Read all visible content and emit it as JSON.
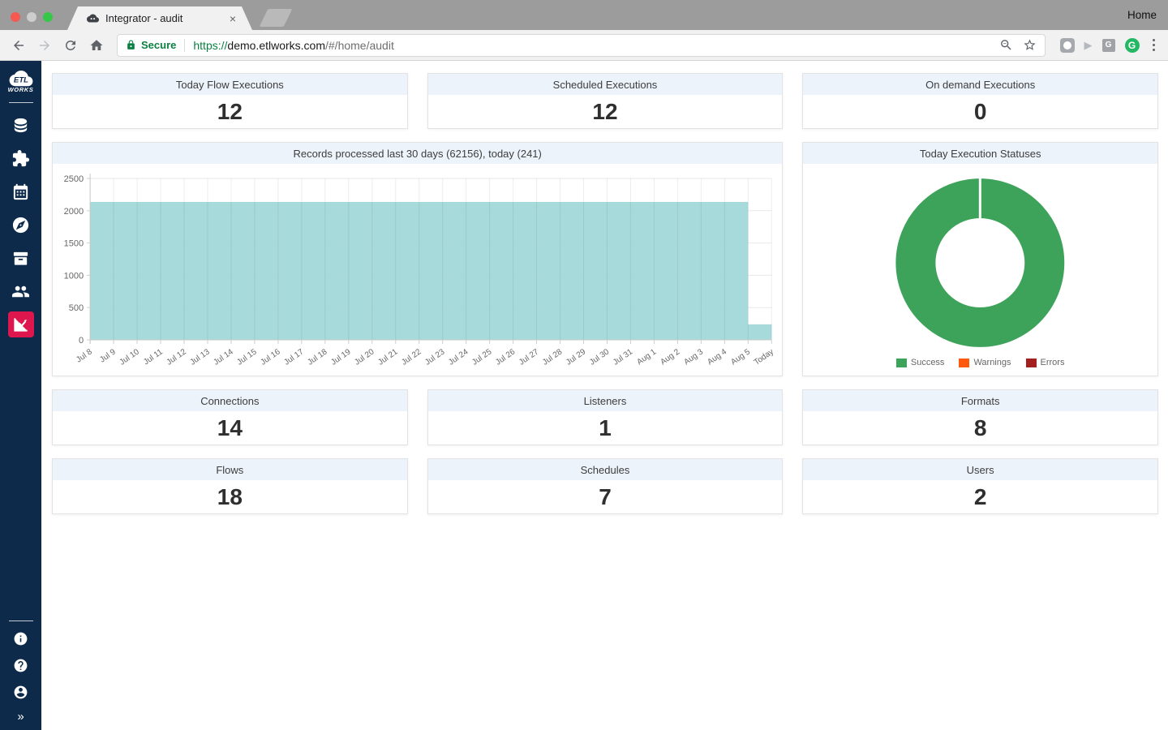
{
  "browser": {
    "frame_home_label": "Home",
    "tab": {
      "title": "Integrator - audit",
      "close_glyph": "×"
    },
    "address": {
      "security_label": "Secure",
      "url_scheme": "https://",
      "url_host": "demo.etlworks.com",
      "url_path": "/#/home/audit"
    },
    "extensions": {
      "g_box_letter": "G",
      "grammarly_letter": "G",
      "play_glyph": "▶"
    }
  },
  "sidebar": {
    "logo": {
      "line1": "ETL",
      "line2": "WORKS"
    },
    "expand_glyph": "»"
  },
  "stats": [
    {
      "title": "Today Flow Executions",
      "value": "12"
    },
    {
      "title": "Scheduled Executions",
      "value": "12"
    },
    {
      "title": "On demand Executions",
      "value": "0"
    },
    {
      "title": "Connections",
      "value": "14"
    },
    {
      "title": "Listeners",
      "value": "1"
    },
    {
      "title": "Formats",
      "value": "8"
    },
    {
      "title": "Flows",
      "value": "18"
    },
    {
      "title": "Schedules",
      "value": "7"
    },
    {
      "title": "Users",
      "value": "2"
    }
  ],
  "chart_data": [
    {
      "type": "area",
      "title": "Records processed last 30 days (62156), today (241)",
      "categories": [
        "Jul 8",
        "Jul 9",
        "Jul 10",
        "Jul 11",
        "Jul 12",
        "Jul 13",
        "Jul 14",
        "Jul 15",
        "Jul 16",
        "Jul 17",
        "Jul 18",
        "Jul 19",
        "Jul 20",
        "Jul 21",
        "Jul 22",
        "Jul 23",
        "Jul 24",
        "Jul 25",
        "Jul 26",
        "Jul 27",
        "Jul 28",
        "Jul 29",
        "Jul 30",
        "Jul 31",
        "Aug 1",
        "Aug 2",
        "Aug 3",
        "Aug 4",
        "Aug 5",
        "Today"
      ],
      "values": [
        2135,
        2135,
        2135,
        2135,
        2135,
        2135,
        2135,
        2135,
        2135,
        2135,
        2135,
        2135,
        2135,
        2135,
        2135,
        2135,
        2135,
        2135,
        2135,
        2135,
        2135,
        2135,
        2135,
        2135,
        2135,
        2135,
        2135,
        2135,
        2135,
        241
      ],
      "total_last_30_days": 62156,
      "today_total": 241,
      "ylim": [
        0,
        2500
      ],
      "yticks": [
        0,
        500,
        1000,
        1500,
        2000,
        2500
      ],
      "grid": true,
      "step": "before",
      "fill_color": "#a2d8d9",
      "legend_position": "none"
    },
    {
      "type": "pie",
      "donut": true,
      "title": "Today Execution Statuses",
      "labels": [
        "Success",
        "Warnings",
        "Errors"
      ],
      "values": [
        12,
        0,
        0
      ],
      "colors": [
        "#3da25a",
        "#ff590d",
        "#a32020"
      ],
      "legend_position": "bottom"
    }
  ],
  "colors": {
    "sidebar_bg": "#0d2a4a",
    "active_item": "#dd164e",
    "card_header_bg": "#ecf3fb",
    "secure_green": "#0b8043"
  }
}
